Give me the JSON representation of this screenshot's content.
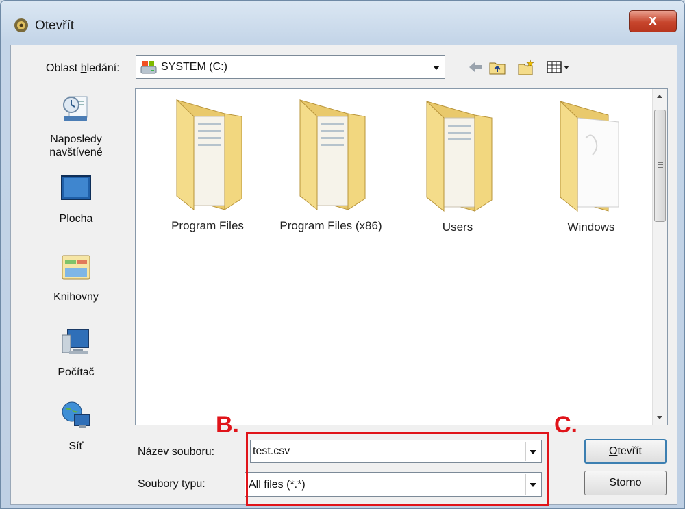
{
  "window": {
    "title": "Otevřít",
    "close_label": "x"
  },
  "toolbar": {
    "lookin_pre": "Oblast ",
    "lookin_u": "h",
    "lookin_post": "ledání:",
    "location": "SYSTEM (C:)",
    "icons": [
      "back-arrow-icon",
      "up-folder-icon",
      "new-folder-icon",
      "view-menu-icon"
    ]
  },
  "places": [
    {
      "label": "Naposledy navštívené",
      "icon": "recent-places-icon"
    },
    {
      "label": "Plocha",
      "icon": "desktop-icon"
    },
    {
      "label": "Knihovny",
      "icon": "libraries-icon"
    },
    {
      "label": "Počítač",
      "icon": "computer-icon"
    },
    {
      "label": "Síť",
      "icon": "network-icon"
    }
  ],
  "files": [
    {
      "name": "Program Files",
      "icon": "folder-icon"
    },
    {
      "name": "Program Files (x86)",
      "icon": "folder-icon"
    },
    {
      "name": "Users",
      "icon": "folder-icon"
    },
    {
      "name": "Windows",
      "icon": "folder-icon"
    }
  ],
  "filename": {
    "label_u": "N",
    "label_rest": "ázev souboru:",
    "value": "test.csv"
  },
  "filetype": {
    "label": "Soubory typu:",
    "value": "All files (*.*)"
  },
  "buttons": {
    "open_u": "O",
    "open_rest": "tevřít",
    "cancel": "Storno"
  },
  "annotations": {
    "b": "B.",
    "c": "C."
  },
  "colors": {
    "annotation_red": "#e0141a",
    "folder_yellow": "#f2d77f"
  }
}
